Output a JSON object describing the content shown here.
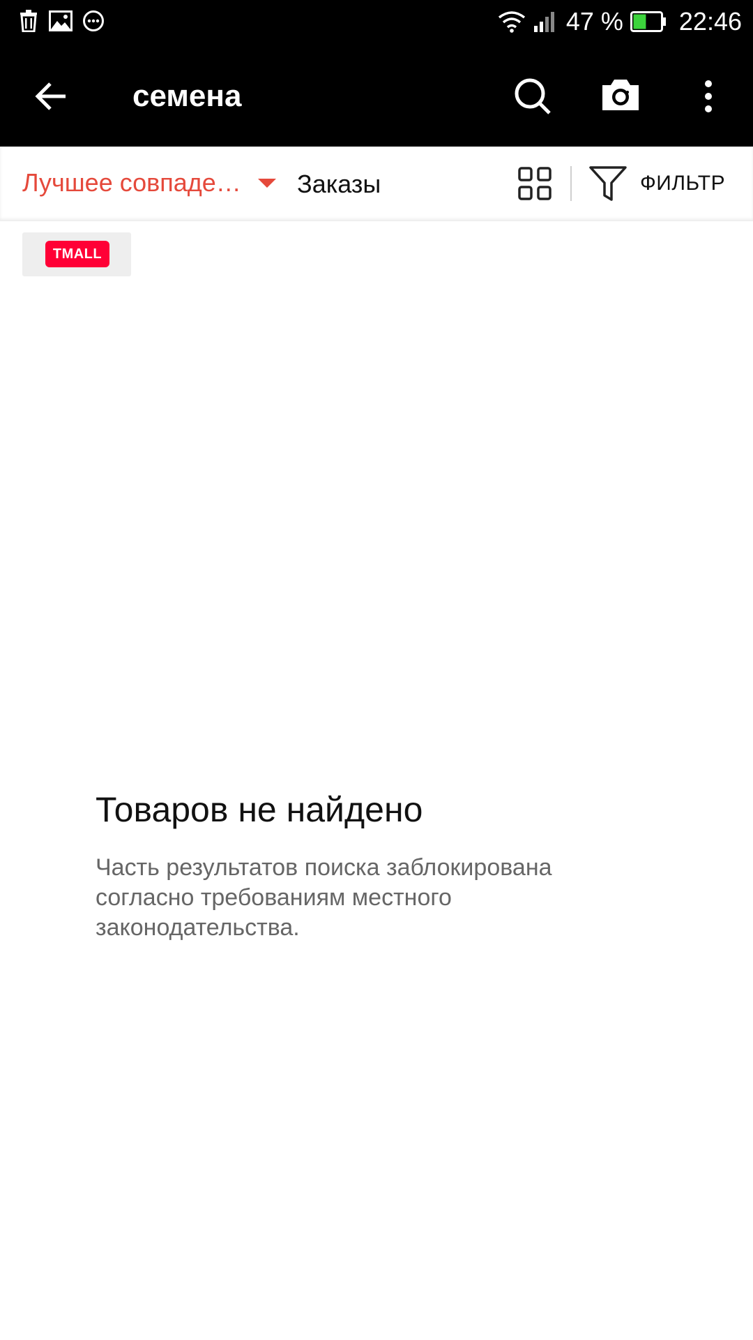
{
  "status_bar": {
    "battery_percent": "47 %",
    "battery_level": 0.47,
    "time": "22:46",
    "icons": [
      "trash-icon",
      "image-icon",
      "chat-icon",
      "wifi-icon",
      "signal-icon",
      "battery-icon"
    ]
  },
  "app_bar": {
    "title": "семена",
    "icons": [
      "back-arrow-icon",
      "search-icon",
      "camera-icon",
      "more-vert-icon"
    ]
  },
  "toolbar": {
    "sort_label": "Лучшее совпаде…",
    "orders_label": "Заказы",
    "filter_label": "ФИЛЬТР",
    "accent_color": "#e5493b"
  },
  "tmall": {
    "logo_text": "TMALL",
    "brand_color": "#ff0036"
  },
  "empty_state": {
    "title": "Товаров не найдено",
    "message": "Часть результатов поиска заблокирована согласно требованиям местного законодательства."
  }
}
